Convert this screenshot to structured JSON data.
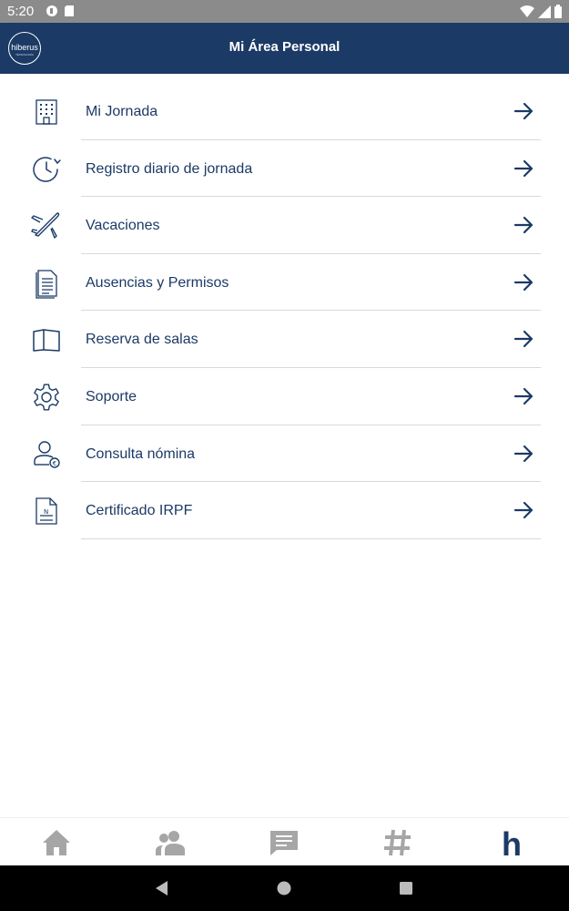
{
  "status_bar": {
    "time": "5:20"
  },
  "app_bar": {
    "logo_text": "hiberus",
    "logo_subtext": "TECNOLOGÍA",
    "title": "Mi Área Personal"
  },
  "menu": {
    "items": [
      {
        "label": "Mi Jornada",
        "icon": "building-icon"
      },
      {
        "label": "Registro diario de jornada",
        "icon": "clock-history-icon"
      },
      {
        "label": "Vacaciones",
        "icon": "airplane-icon"
      },
      {
        "label": "Ausencias y Permisos",
        "icon": "document-icon"
      },
      {
        "label": "Reserva de salas",
        "icon": "map-icon"
      },
      {
        "label": "Soporte",
        "icon": "gear-icon"
      },
      {
        "label": "Consulta nómina",
        "icon": "user-euro-icon"
      },
      {
        "label": "Certificado IRPF",
        "icon": "certificate-icon"
      }
    ]
  },
  "bottom_nav": {
    "tabs": [
      "home-icon",
      "people-icon",
      "chat-icon",
      "hashtag-icon",
      "hiberus-h-icon"
    ],
    "active": "hiberus-h-icon"
  },
  "colors": {
    "primary": "#1b3a66",
    "status_bar": "#8b8b8b",
    "inactive_tab": "#a6a6a6"
  }
}
